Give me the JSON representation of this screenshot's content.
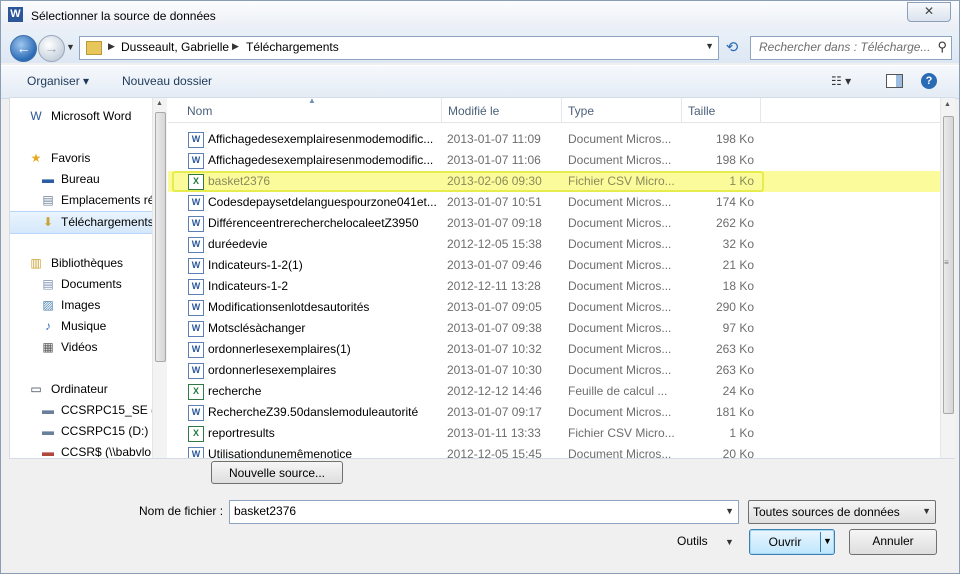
{
  "window": {
    "title": "Sélectionner la source de données",
    "close": "✕"
  },
  "nav": {
    "back": "←",
    "forward": "→",
    "breadcrumb": [
      "Dusseault, Gabrielle",
      "Téléchargements"
    ],
    "search_placeholder": "Rechercher dans : Télécharge..."
  },
  "toolbar": {
    "organize": "Organiser ▾",
    "new_folder": "Nouveau dossier",
    "view": "☷ ▾",
    "help": "?"
  },
  "sidebar": [
    {
      "label": "Microsoft Word",
      "icon": "word-icon",
      "glyph": "W"
    },
    {
      "label": "Favoris",
      "icon": "star-icon",
      "glyph": "★"
    },
    {
      "label": "Bureau",
      "icon": "desktop-icon",
      "glyph": "▬"
    },
    {
      "label": "Emplacements ré",
      "icon": "recent-places-icon",
      "glyph": "▤"
    },
    {
      "label": "Téléchargements",
      "icon": "downloads-folder-icon",
      "glyph": "⬇"
    },
    {
      "label": "Bibliothèques",
      "icon": "libraries-icon",
      "glyph": "▥"
    },
    {
      "label": "Documents",
      "icon": "documents-icon",
      "glyph": "▤"
    },
    {
      "label": "Images",
      "icon": "images-icon",
      "glyph": "▨"
    },
    {
      "label": "Musique",
      "icon": "music-icon",
      "glyph": "♪"
    },
    {
      "label": "Vidéos",
      "icon": "videos-icon",
      "glyph": "▦"
    },
    {
      "label": "Ordinateur",
      "icon": "computer-icon",
      "glyph": "▭"
    },
    {
      "label": "CCSRPC15_SE (C:",
      "icon": "drive-c-icon",
      "glyph": "▬"
    },
    {
      "label": "CCSRPC15 (D:)",
      "icon": "drive-d-icon",
      "glyph": "▬"
    },
    {
      "label": "CCSR$ (\\\\babvlo",
      "icon": "network-drive-icon",
      "glyph": "▬"
    }
  ],
  "columns": {
    "name": "Nom",
    "modified": "Modifié le",
    "type": "Type",
    "size": "Taille"
  },
  "files": [
    {
      "name": "Affichagedesexemplairesenmodemodific...",
      "modified": "2013-01-07 11:09",
      "type": "Document Micros...",
      "size": "198 Ko",
      "icon": "W"
    },
    {
      "name": "Affichagedesexemplairesenmodemodific...",
      "modified": "2013-01-07 11:06",
      "type": "Document Micros...",
      "size": "198 Ko",
      "icon": "W"
    },
    {
      "name": "basket2376",
      "modified": "2013-02-06 09:30",
      "type": "Fichier CSV Micro...",
      "size": "1 Ko",
      "icon": "X"
    },
    {
      "name": "Codesdepaysetdelanguespourzone041et...",
      "modified": "2013-01-07 10:51",
      "type": "Document Micros...",
      "size": "174 Ko",
      "icon": "W"
    },
    {
      "name": "DifférenceentrerecherchelocaleetZ3950",
      "modified": "2013-01-07 09:18",
      "type": "Document Micros...",
      "size": "262 Ko",
      "icon": "W"
    },
    {
      "name": "duréedevie",
      "modified": "2012-12-05 15:38",
      "type": "Document Micros...",
      "size": "32 Ko",
      "icon": "W"
    },
    {
      "name": "Indicateurs-1-2(1)",
      "modified": "2013-01-07 09:46",
      "type": "Document Micros...",
      "size": "21 Ko",
      "icon": "W"
    },
    {
      "name": "Indicateurs-1-2",
      "modified": "2012-12-11 13:28",
      "type": "Document Micros...",
      "size": "18 Ko",
      "icon": "W"
    },
    {
      "name": "Modificationsenlotdesautorités",
      "modified": "2013-01-07 09:05",
      "type": "Document Micros...",
      "size": "290 Ko",
      "icon": "W"
    },
    {
      "name": "Motsclésàchanger",
      "modified": "2013-01-07 09:38",
      "type": "Document Micros...",
      "size": "97 Ko",
      "icon": "W"
    },
    {
      "name": "ordonnerlesexemplaires(1)",
      "modified": "2013-01-07 10:32",
      "type": "Document Micros...",
      "size": "263 Ko",
      "icon": "W"
    },
    {
      "name": "ordonnerlesexemplaires",
      "modified": "2013-01-07 10:30",
      "type": "Document Micros...",
      "size": "263 Ko",
      "icon": "W"
    },
    {
      "name": "recherche",
      "modified": "2012-12-12 14:46",
      "type": "Feuille de calcul ...",
      "size": "24 Ko",
      "icon": "X"
    },
    {
      "name": "RechercheZ39.50danslemoduleautorité",
      "modified": "2013-01-07 09:17",
      "type": "Document Micros...",
      "size": "181 Ko",
      "icon": "W"
    },
    {
      "name": "reportresults",
      "modified": "2013-01-11 13:33",
      "type": "Fichier CSV Micro...",
      "size": "1 Ko",
      "icon": "X"
    },
    {
      "name": "Utilisationdunemêmenotice",
      "modified": "2012-12-05 15:45",
      "type": "Document Micros...",
      "size": "20 Ko",
      "icon": "W"
    }
  ],
  "footer": {
    "new_source": "Nouvelle source...",
    "filename_label": "Nom de fichier :",
    "filename_value": "basket2376",
    "filter": "Toutes sources de données",
    "tools": "Outils",
    "open": "Ouvrir",
    "cancel": "Annuler"
  },
  "colors": {
    "highlight": "#fbfb9b",
    "highlight_border": "#e6ec4e",
    "accent": "#2a6bb5"
  }
}
